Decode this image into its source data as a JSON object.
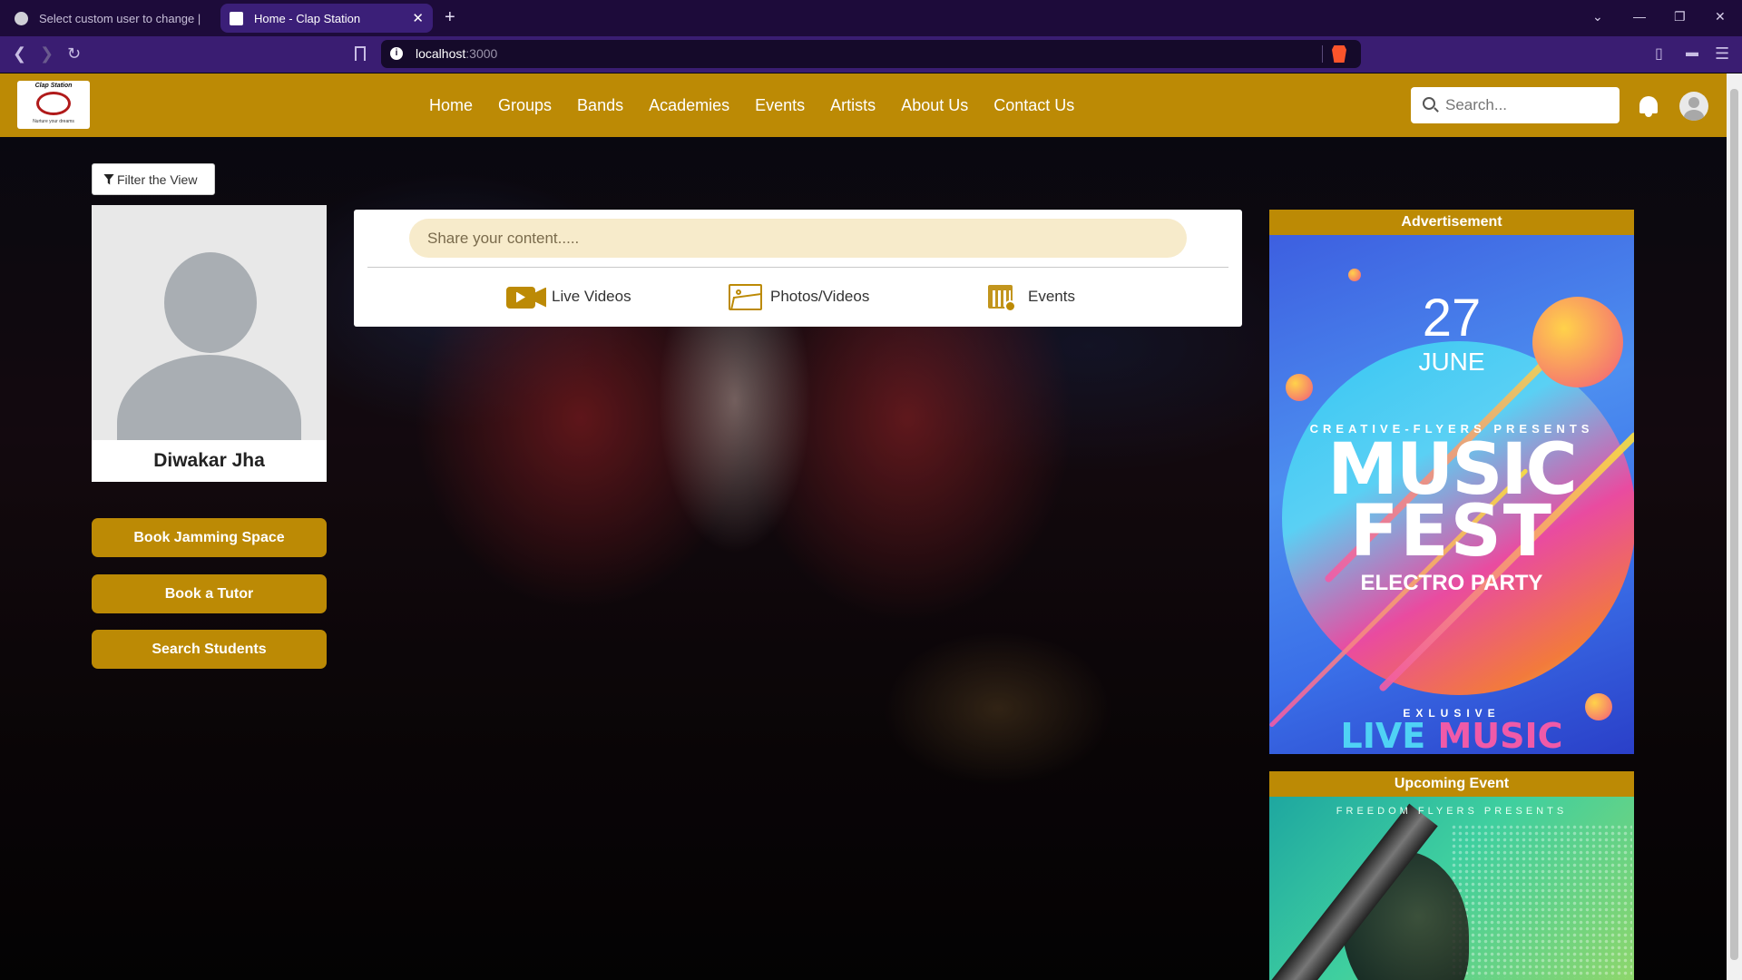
{
  "browser": {
    "tabs": [
      {
        "title": "Select custom user to change | Djan",
        "active": false
      },
      {
        "title": "Home - Clap Station",
        "active": true
      }
    ],
    "url_host": "localhost",
    "url_port": ":3000"
  },
  "navbar": {
    "logo_caption": "Clap Station",
    "logo_tagline": "Nurture your dreams",
    "menu": [
      "Home",
      "Groups",
      "Bands",
      "Academies",
      "Events",
      "Artists",
      "About Us",
      "Contact Us"
    ],
    "search_placeholder": "Search..."
  },
  "sidebar": {
    "filter_label": "Filter the View",
    "user_name": "Diwakar Jha",
    "buttons": [
      "Book Jamming Space",
      "Book a Tutor",
      "Search Students"
    ]
  },
  "composer": {
    "placeholder": "Share your content.....",
    "options": [
      "Live Videos",
      "Photos/Videos",
      "Events"
    ]
  },
  "right_panel": {
    "advertisement_title": "Advertisement",
    "ad_poster": {
      "day": "27",
      "month": "JUNE",
      "presenter": "CREATIVE-FLYERS PRESENTS",
      "line1": "MUSIC",
      "line2": "FEST",
      "subtitle": "ELECTRO PARTY",
      "exclusive": "EXLUSIVE",
      "live1": "LIVE ",
      "live2": "MUSIC"
    },
    "upcoming_title": "Upcoming Event",
    "upcoming_poster": {
      "presenter": "FREEDOM FLYERS PRESENTS"
    }
  },
  "colors": {
    "brand_gold": "#bc8a05",
    "composer_input_bg": "#f7ebcb",
    "browser_tabbar": "#1d0b3a",
    "browser_addrbar": "#3a1d72"
  }
}
